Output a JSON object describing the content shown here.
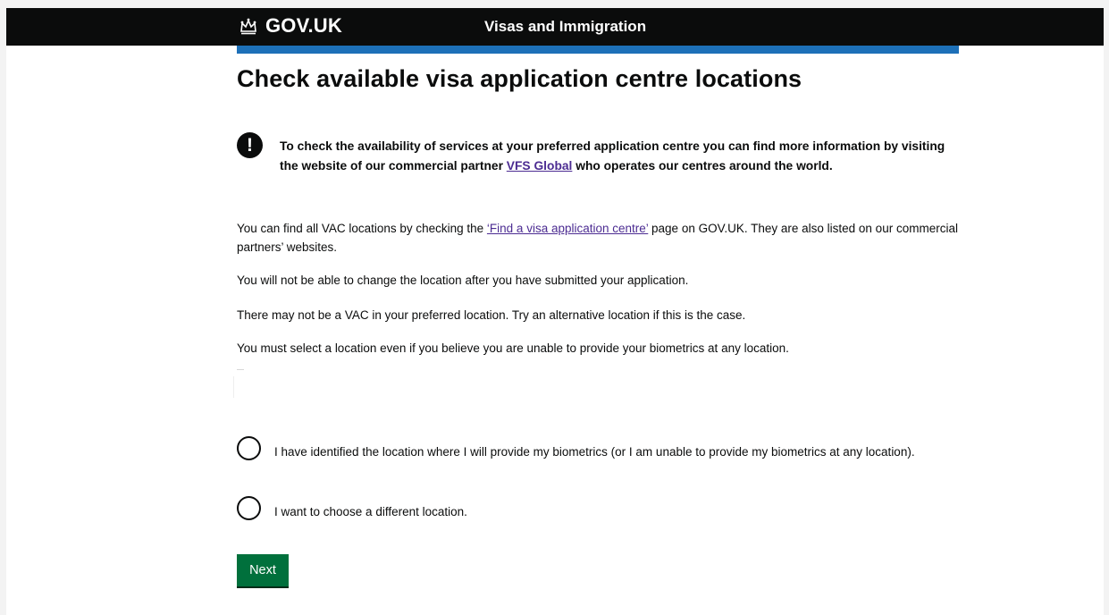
{
  "header": {
    "logo_text": "GOV.UK",
    "logo_icon": "crown-icon",
    "service_name": "Visas and Immigration"
  },
  "main": {
    "title": "Check available visa application centre locations",
    "warning": {
      "icon": "exclamation-icon",
      "text_before_link": "To check the availability of services at your preferred application centre you can find more information by visiting the website of our commercial partner ",
      "link_text": "VFS Global",
      "text_after_link": " who operates our centres around the world."
    },
    "paragraph1": {
      "text_before_link": "You can find all VAC locations by checking the ",
      "link_text": "‘Find a visa application centre’",
      "text_after_link": " page on GOV.UK. They are also listed on our commercial partners’ websites."
    },
    "paragraph2": "You will not be able to change the location after you have submitted your application.",
    "paragraph3": "There may not be a VAC in your preferred location. Try an alternative location if this is the case.",
    "paragraph4": "You must select a location even if you believe you are unable to provide your biometrics at any location.",
    "options": [
      {
        "label": "I have identified the location where I will provide my biometrics (or I am unable to provide my biometrics at any location).",
        "selected": false
      },
      {
        "label": "I want to choose a different location.",
        "selected": false
      }
    ],
    "next_label": "Next"
  },
  "colors": {
    "header_bg": "#0b0c0c",
    "accent_bar": "#1d70b8",
    "link": "#4c2c92",
    "button": "#00703c"
  }
}
